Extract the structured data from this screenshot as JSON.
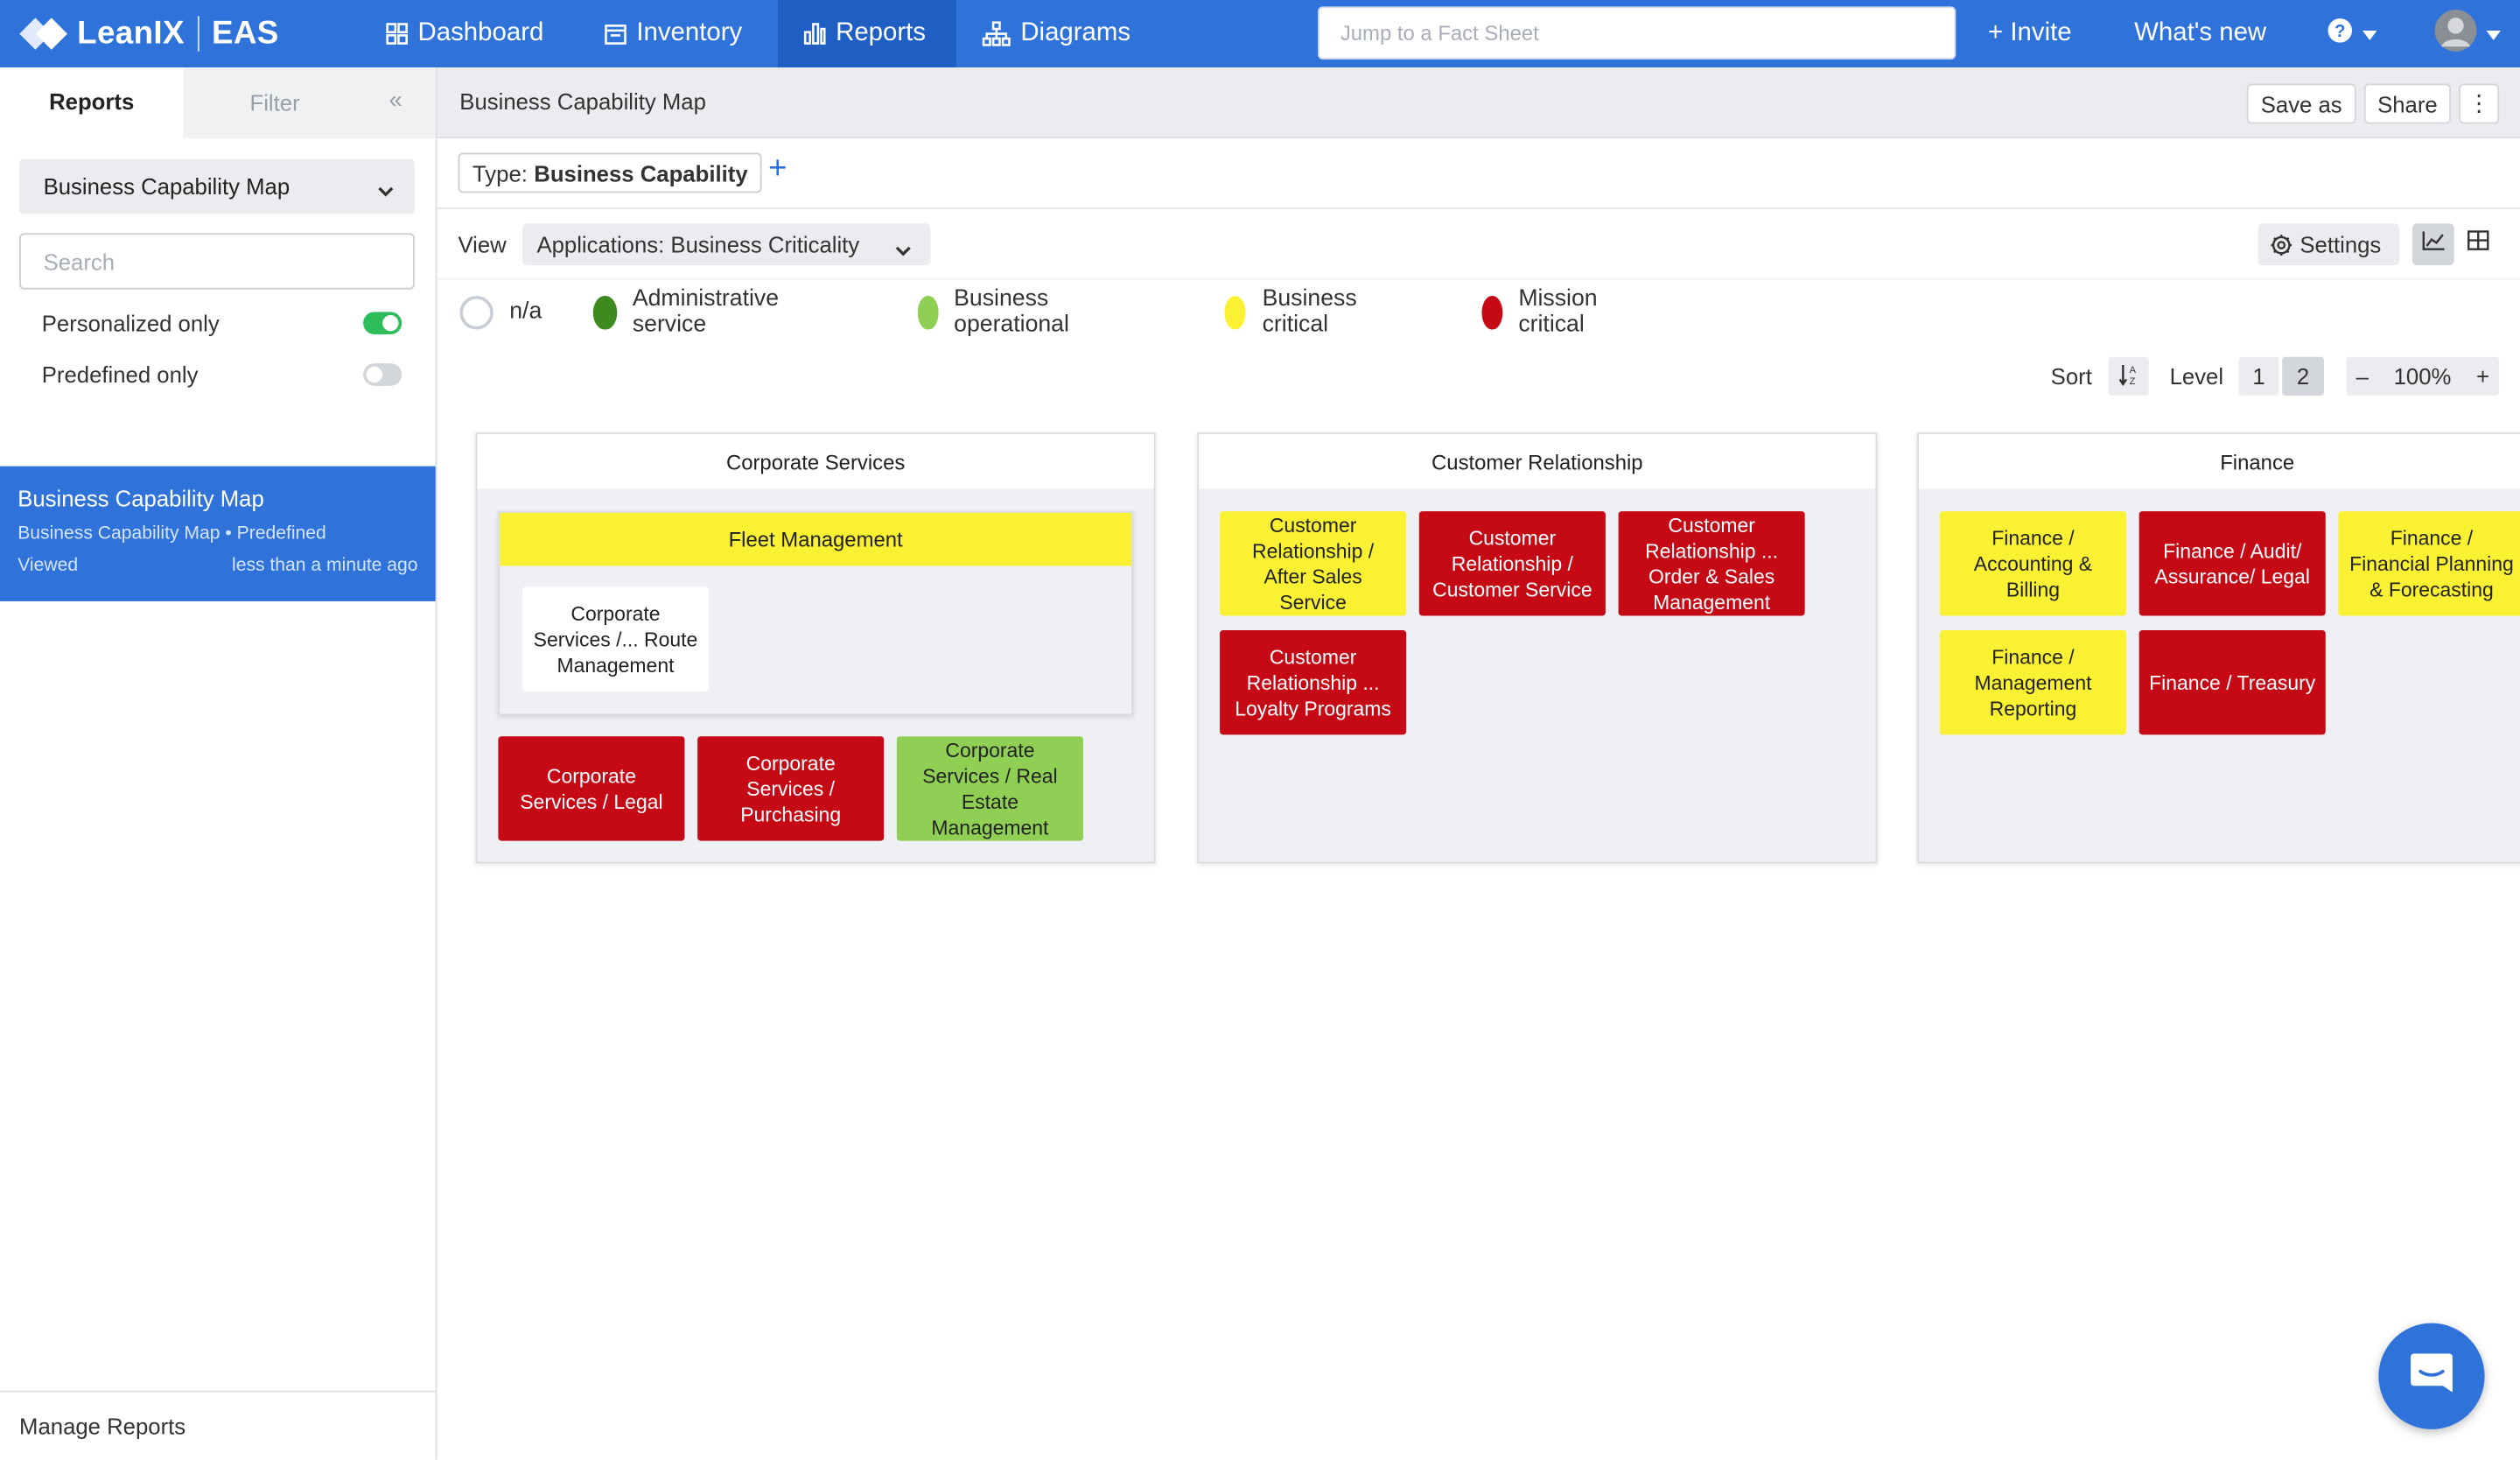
{
  "app": {
    "brand": "LeanIX",
    "product": "EAS",
    "nav": [
      {
        "label": "Dashboard",
        "icon": "dashboard-icon"
      },
      {
        "label": "Inventory",
        "icon": "inventory-icon"
      },
      {
        "label": "Reports",
        "icon": "reports-icon",
        "active": true
      },
      {
        "label": "Diagrams",
        "icon": "diagrams-icon"
      }
    ],
    "search_placeholder": "Jump to a Fact Sheet",
    "invite_label": "+ Invite",
    "whats_new_label": "What's new",
    "accent_color": "#2f73da"
  },
  "sidebar": {
    "tabs": [
      "Reports",
      "Filter"
    ],
    "collapse_icon": "«",
    "report_select": "Business Capability Map",
    "search_placeholder": "Search",
    "personalized_label": "Personalized only",
    "personalized_on": true,
    "predefined_label": "Predefined only",
    "predefined_on": false,
    "report_card": {
      "title": "Business Capability Map",
      "subtitle": "Business Capability Map • Predefined",
      "viewed_label": "Viewed",
      "viewed_time": "less than a minute ago"
    },
    "manage_label": "Manage Reports"
  },
  "header": {
    "title": "Business Capability Map",
    "save_as_label": "Save as",
    "share_label": "Share",
    "more_icon": "⋮"
  },
  "filter": {
    "type_prefix": "Type:",
    "type_value": "Business Capability",
    "add_icon": "+"
  },
  "view": {
    "label": "View",
    "selected": "Applications: Business Criticality",
    "settings_label": "Settings"
  },
  "legend": [
    {
      "label": "n/a",
      "color": "#ffffff"
    },
    {
      "label": "Administrative service",
      "color": "#3f8a1e"
    },
    {
      "label": "Business operational",
      "color": "#8fd054"
    },
    {
      "label": "Business critical",
      "color": "#fbf133"
    },
    {
      "label": "Mission critical",
      "color": "#c50a16"
    }
  ],
  "controls": {
    "sort_label": "Sort",
    "level_label": "Level",
    "levels": [
      "1",
      "2"
    ],
    "selected_level": "2",
    "zoom_minus": "–",
    "zoom_value": "100%",
    "zoom_plus": "+"
  },
  "map": {
    "columns": [
      {
        "title": "Corporate Services",
        "group": {
          "title": "Fleet Management",
          "children": [
            {
              "label": "Corporate Services /... Route Management",
              "status": "white"
            }
          ]
        },
        "tiles": [
          {
            "label": "Corporate Services / Legal",
            "status": "red"
          },
          {
            "label": "Corporate Services / Purchasing",
            "status": "red"
          },
          {
            "label": "Corporate Services / Real Estate Management",
            "status": "lgreen"
          }
        ]
      },
      {
        "title": "Customer Relationship",
        "tiles": [
          {
            "label": "Customer Relationship / After Sales Service",
            "status": "yellow"
          },
          {
            "label": "Customer Relationship / Customer Service",
            "status": "red"
          },
          {
            "label": "Customer Relationship ... Order & Sales Management",
            "status": "red"
          },
          {
            "label": "Customer Relationship ... Loyalty Programs",
            "status": "red"
          }
        ]
      },
      {
        "title": "Finance",
        "tiles": [
          {
            "label": "Finance / Accounting & Billing",
            "status": "yellow"
          },
          {
            "label": "Finance / Audit/ Assurance/ Legal",
            "status": "red"
          },
          {
            "label": "Finance / Financial Planning & Forecasting",
            "status": "yellow"
          },
          {
            "label": "Finance / Management Reporting",
            "status": "yellow"
          },
          {
            "label": "Finance / Treasury",
            "status": "red"
          }
        ]
      }
    ]
  }
}
